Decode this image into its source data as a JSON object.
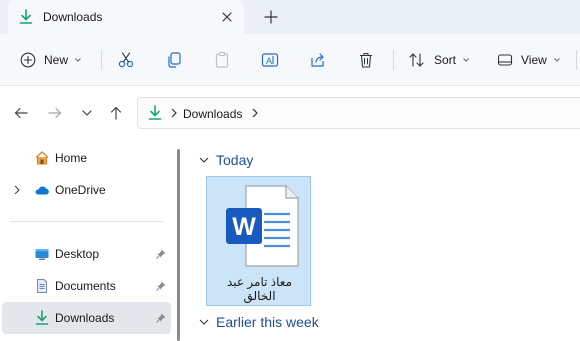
{
  "tab": {
    "title": "Downloads"
  },
  "toolbar": {
    "new_label": "New",
    "sort_label": "Sort",
    "view_label": "View"
  },
  "address": {
    "crumb": "Downloads"
  },
  "sidebar": {
    "items": [
      {
        "label": "Home",
        "icon": "home-icon"
      },
      {
        "label": "OneDrive",
        "icon": "onedrive-icon"
      },
      {
        "label": "Desktop",
        "icon": "desktop-icon",
        "pinned": true
      },
      {
        "label": "Documents",
        "icon": "documents-icon",
        "pinned": true
      },
      {
        "label": "Downloads",
        "icon": "downloads-icon",
        "pinned": true,
        "selected": true
      }
    ]
  },
  "content": {
    "groups": [
      {
        "label": "Today"
      },
      {
        "label": "Earlier this week"
      }
    ],
    "files": [
      {
        "name": "معاذ تامر عبد الخالق",
        "type": "word-document"
      }
    ]
  },
  "colors": {
    "accent": "#0f6cbd",
    "download_green": "#1aa37a",
    "word_blue": "#185abd",
    "selection": "#cce4f7"
  }
}
